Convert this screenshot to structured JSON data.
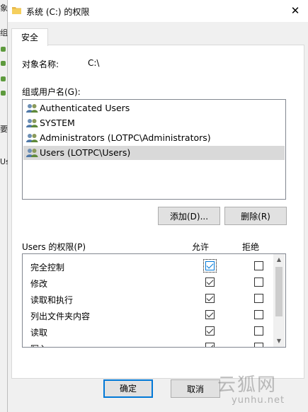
{
  "background_window": {
    "fragments": [
      "象",
      "组",
      "要",
      "Us"
    ]
  },
  "titlebar": {
    "title": "系统 (C:) 的权限",
    "close_glyph": "✕"
  },
  "tab": {
    "label": "安全"
  },
  "object_name": {
    "label": "对象名称:",
    "value": "C:\\"
  },
  "groups": {
    "label": "组或用户名(G):",
    "items": [
      {
        "name": "Authenticated Users",
        "selected": false
      },
      {
        "name": "SYSTEM",
        "selected": false
      },
      {
        "name": "Administrators (LOTPC\\Administrators)",
        "selected": false
      },
      {
        "name": "Users (LOTPC\\Users)",
        "selected": true
      }
    ]
  },
  "buttons": {
    "add": "添加(D)...",
    "remove": "删除(R)",
    "ok": "确定",
    "cancel": "取消"
  },
  "permissions": {
    "label": "Users 的权限(P)",
    "allow_header": "允许",
    "deny_header": "拒绝",
    "items": [
      {
        "name": "完全控制",
        "allow": false,
        "deny": false
      },
      {
        "name": "修改",
        "allow": true,
        "deny": false
      },
      {
        "name": "读取和执行",
        "allow": true,
        "deny": false
      },
      {
        "name": "列出文件夹内容",
        "allow": true,
        "deny": false
      },
      {
        "name": "读取",
        "allow": true,
        "deny": false
      },
      {
        "name": "写入",
        "allow": true,
        "deny": false
      }
    ]
  },
  "watermark": {
    "text": "云狐网",
    "url": "yunhu.net"
  },
  "colors": {
    "accent": "#0078d7",
    "selection": "#d9d9d9",
    "face": "#f0f0f0"
  }
}
